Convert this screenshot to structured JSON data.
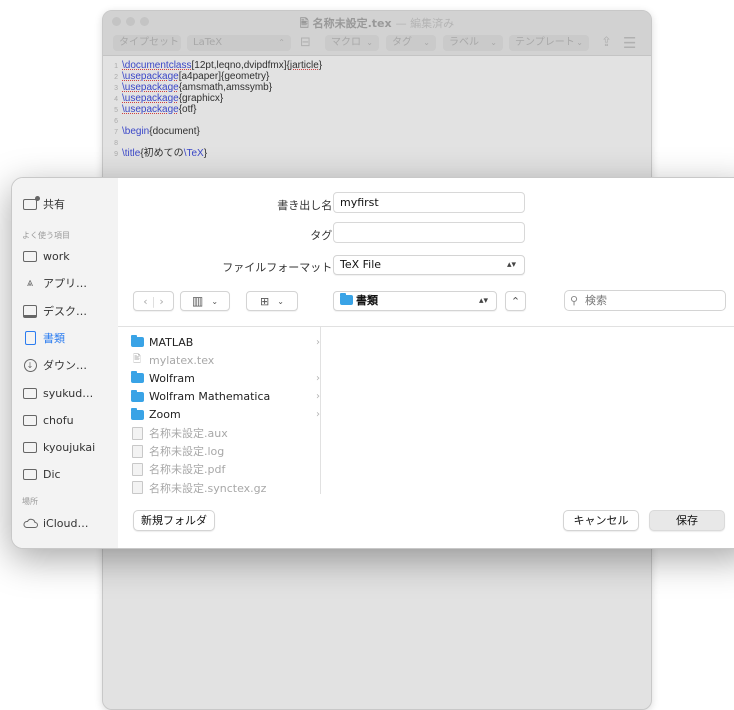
{
  "editor": {
    "title": "名称未設定.tex",
    "title_suffix": "— 編集済み",
    "doc_icon": "tex-document-icon",
    "toolbar": {
      "typeset": "タイプセット",
      "engine": "LaTeX",
      "macro": "マクロ",
      "tag": "タグ",
      "label": "ラベル",
      "template": "テンプレート"
    },
    "code_lines": [
      {
        "n": "1",
        "parts": [
          {
            "t": "\\documentclass",
            "cmd": true,
            "ul": true
          },
          {
            "t": "[12pt,leqno,dvipdfmx]{"
          },
          {
            "t": "jarticle",
            "ul": true
          },
          {
            "t": "}"
          }
        ]
      },
      {
        "n": "2",
        "parts": [
          {
            "t": "\\usepackage",
            "cmd": true,
            "ul": true
          },
          {
            "t": "[a4paper]{geometry}"
          }
        ]
      },
      {
        "n": "3",
        "parts": [
          {
            "t": "\\usepackage",
            "cmd": true,
            "ul": true
          },
          {
            "t": "{amsmath,amssymb}"
          }
        ]
      },
      {
        "n": "4",
        "parts": [
          {
            "t": "\\usepackage",
            "cmd": true,
            "ul": true
          },
          {
            "t": "{graphicx}"
          }
        ]
      },
      {
        "n": "5",
        "parts": [
          {
            "t": "\\usepackage",
            "cmd": true,
            "ul": true
          },
          {
            "t": "{otf}"
          }
        ]
      },
      {
        "n": "6",
        "parts": []
      },
      {
        "n": "7",
        "parts": [
          {
            "t": "\\begin",
            "cmd": true
          },
          {
            "t": "{document}"
          }
        ]
      },
      {
        "n": "8",
        "parts": []
      },
      {
        "n": "9",
        "parts": [
          {
            "t": "\\title",
            "cmd": true
          },
          {
            "t": "{初めての"
          },
          {
            "t": "\\TeX",
            "cmd": true
          },
          {
            "t": "}"
          }
        ]
      }
    ]
  },
  "dialog": {
    "sidebar": {
      "shared": {
        "label": "共有",
        "icon": "shared-folder-icon"
      },
      "favorites_header": "よく使う項目",
      "favorites": [
        {
          "label": "work",
          "icon": "folder-icon"
        },
        {
          "label": "アプリ…",
          "icon": "applications-icon"
        },
        {
          "label": "デスク…",
          "icon": "desktop-icon"
        },
        {
          "label": "書類",
          "icon": "document-icon",
          "active": true
        },
        {
          "label": "ダウン…",
          "icon": "download-icon"
        },
        {
          "label": "syukud…",
          "icon": "folder-icon"
        },
        {
          "label": "chofu",
          "icon": "folder-icon"
        },
        {
          "label": "kyoujukai",
          "icon": "folder-icon"
        },
        {
          "label": "Dic",
          "icon": "folder-icon"
        }
      ],
      "locations_header": "場所",
      "locations": [
        {
          "label": "iCloud…",
          "icon": "cloud-icon"
        }
      ]
    },
    "save_as_label": "書き出し名:",
    "save_as_value": "myfirst",
    "tags_label": "タグ:",
    "tags_value": "",
    "format_label": "ファイルフォーマット:",
    "format_value": "TeX File",
    "location_value": "書類",
    "search_placeholder": "検索",
    "files": [
      {
        "name": "MATLAB",
        "kind": "folder",
        "chevron": true
      },
      {
        "name": "mylatex.tex",
        "kind": "tex",
        "dim": true
      },
      {
        "name": "Wolfram",
        "kind": "folder",
        "chevron": true
      },
      {
        "name": "Wolfram Mathematica",
        "kind": "folder",
        "chevron": true
      },
      {
        "name": "Zoom",
        "kind": "folder",
        "chevron": true
      },
      {
        "name": "名称未設定.aux",
        "kind": "doc",
        "dim": true
      },
      {
        "name": "名称未設定.log",
        "kind": "doc",
        "dim": true
      },
      {
        "name": "名称未設定.pdf",
        "kind": "doc",
        "dim": true
      },
      {
        "name": "名称未設定.synctex.gz",
        "kind": "doc",
        "dim": true
      }
    ],
    "new_folder_label": "新規フォルダ",
    "cancel_label": "キャンセル",
    "save_label": "保存"
  }
}
